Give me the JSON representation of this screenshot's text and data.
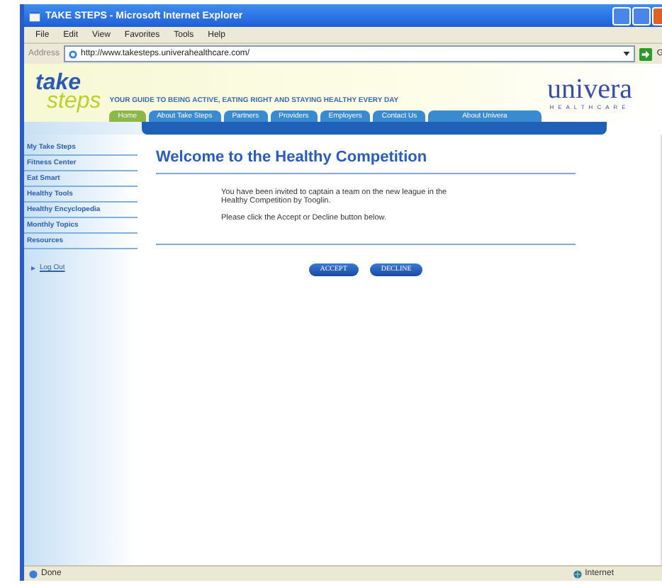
{
  "window": {
    "title": "TAKE STEPS - Microsoft Internet Explorer"
  },
  "menu": [
    "File",
    "Edit",
    "View",
    "Favorites",
    "Tools",
    "Help"
  ],
  "address_bar": {
    "label": "Address",
    "url": "http://www.takesteps.univerahealthcare.com/",
    "go": "G"
  },
  "header": {
    "logo_top": "take",
    "logo_bottom": "steps",
    "tagline": "YOUR GUIDE TO BEING ACTIVE, EATING RIGHT AND STAYING HEALTHY EVERY DAY",
    "brand": "univera",
    "brand_sub": "HEALTHCARE"
  },
  "tabs": [
    {
      "label": "Home",
      "selected": true
    },
    {
      "label": "About Take Steps",
      "selected": false
    },
    {
      "label": "Partners",
      "selected": false
    },
    {
      "label": "Providers",
      "selected": false
    },
    {
      "label": "Employers",
      "selected": false
    },
    {
      "label": "Contact Us",
      "selected": false
    },
    {
      "label": "About Univera",
      "selected": false
    }
  ],
  "sidebar": {
    "items": [
      "My Take Steps",
      "Fitness Center",
      "Eat Smart",
      "Healthy Tools",
      "Healthy Encyclopedia",
      "Monthly Topics",
      "Resources"
    ],
    "logout": "Log Out"
  },
  "content": {
    "heading": "Welcome to the Healthy Competition",
    "paragraphs": [
      "You have been invited to captain a team on the new league in the Healthy Competition by Tooglin.",
      "Please click the Accept or Decline button below."
    ],
    "buttons": [
      "ACCEPT",
      "DECLINE"
    ]
  },
  "status_bar": {
    "text": "Done",
    "zone": "Internet"
  }
}
